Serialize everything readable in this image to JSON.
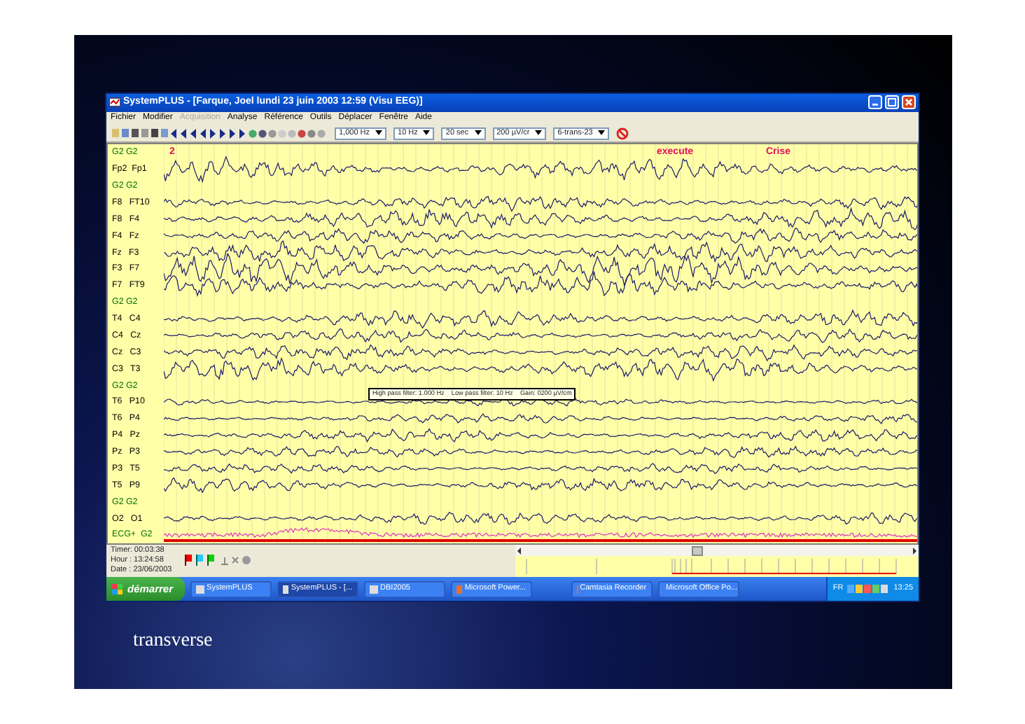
{
  "window": {
    "title": "SystemPLUS - [Farque, Joel lundi 23 juin 2003 12:59 (Visu EEG)]"
  },
  "menu": [
    {
      "label": "Fichier",
      "disabled": false
    },
    {
      "label": "Modifier",
      "disabled": false
    },
    {
      "label": "Acquisition",
      "disabled": true
    },
    {
      "label": "Analyse",
      "disabled": false
    },
    {
      "label": "Référence",
      "disabled": false
    },
    {
      "label": "Outils",
      "disabled": false
    },
    {
      "label": "Déplacer",
      "disabled": false
    },
    {
      "label": "Fenêtre",
      "disabled": false
    },
    {
      "label": "Aide",
      "disabled": false
    }
  ],
  "toolbar": {
    "dropdowns": [
      "1,000 Hz",
      "10 Hz",
      "20 sec",
      "200 µV/cr",
      "6-trans-23"
    ]
  },
  "markers": [
    "2",
    "execute",
    "Crise"
  ],
  "channels": [
    {
      "label": "G2 G2",
      "kind": "blank"
    },
    {
      "label": "Fp2  Fp1",
      "kind": "trace"
    },
    {
      "label": "G2 G2",
      "kind": "blank"
    },
    {
      "label": "F8   FT10",
      "kind": "trace"
    },
    {
      "label": "F8   F4",
      "kind": "trace"
    },
    {
      "label": "F4   Fz",
      "kind": "trace"
    },
    {
      "label": "Fz   F3",
      "kind": "trace"
    },
    {
      "label": "F3   F7",
      "kind": "trace"
    },
    {
      "label": "F7   FT9",
      "kind": "trace"
    },
    {
      "label": "G2 G2",
      "kind": "blank"
    },
    {
      "label": "T4   C4",
      "kind": "trace"
    },
    {
      "label": "C4   Cz",
      "kind": "trace"
    },
    {
      "label": "Cz   C3",
      "kind": "trace"
    },
    {
      "label": "C3   T3",
      "kind": "trace"
    },
    {
      "label": "G2 G2",
      "kind": "blank"
    },
    {
      "label": "T6   P10",
      "kind": "trace"
    },
    {
      "label": "T6   P4",
      "kind": "trace"
    },
    {
      "label": "P4   Pz",
      "kind": "trace"
    },
    {
      "label": "Pz   P3",
      "kind": "trace"
    },
    {
      "label": "P3   T5",
      "kind": "trace"
    },
    {
      "label": "T5   P9",
      "kind": "trace"
    },
    {
      "label": "G2 G2",
      "kind": "blank"
    },
    {
      "label": "O2   O1",
      "kind": "trace"
    },
    {
      "label": "ECG+  G2",
      "kind": "ecg"
    }
  ],
  "filter_info": "High pass filter: 1.000 Hz    Low pass filter: 10 Hz    Gain: 0200 µV/cm",
  "status": {
    "timer": "Timer: 00:03:38",
    "hour": "Hour : 13:24:58",
    "date": "Date : 23/06/2003"
  },
  "taskbar": {
    "start": "démarrer",
    "items": [
      {
        "label": "SystemPLUS",
        "selected": false
      },
      {
        "label": "SystemPLUS - [...",
        "selected": true
      },
      {
        "label": "DBI2005",
        "selected": false
      },
      {
        "label": "Microsoft Power...",
        "selected": false
      },
      {
        "label": "Camtasia Recorder",
        "selected": false
      },
      {
        "label": "Microsoft Office Po...",
        "selected": false
      }
    ],
    "language": "FR",
    "clock": "13:25"
  },
  "slide": {
    "caption": "transverse"
  }
}
